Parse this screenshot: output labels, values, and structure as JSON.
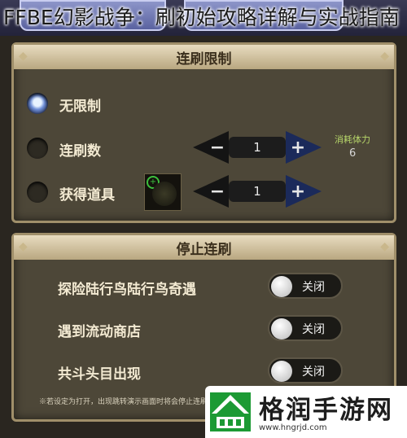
{
  "overlay_title": "FFBE幻影战争：刷初始攻略详解与实战指南",
  "repeat_panel": {
    "header": "连刷限制",
    "options": [
      {
        "label": "无限制",
        "selected": true
      },
      {
        "label": "连刷数",
        "selected": false
      },
      {
        "label": "获得道具",
        "selected": false
      }
    ],
    "repeat_count_value": "1",
    "item_count_value": "1",
    "stamina_label": "消耗体力",
    "stamina_value": "6",
    "minus_symbol": "−",
    "plus_symbol": "+"
  },
  "stop_panel": {
    "header": "停止连刷",
    "rows": [
      {
        "label": "探险陆行鸟陆行鸟奇遇",
        "toggle_label": "关闭"
      },
      {
        "label": "遇到流动商店",
        "toggle_label": "关闭"
      },
      {
        "label": "共斗头目出现",
        "toggle_label": "关闭"
      }
    ],
    "note": "※若设定为打开，出现跳转演示画面时将会停止连刷"
  },
  "watermark": {
    "name": "格润手游网",
    "url": "www.hngrjd.com"
  },
  "colors": {
    "panel_bg": "#4d4738",
    "panel_border": "#a08f6a",
    "header_bg": "#d8c9a3",
    "stamina_green": "#b7d66a"
  }
}
